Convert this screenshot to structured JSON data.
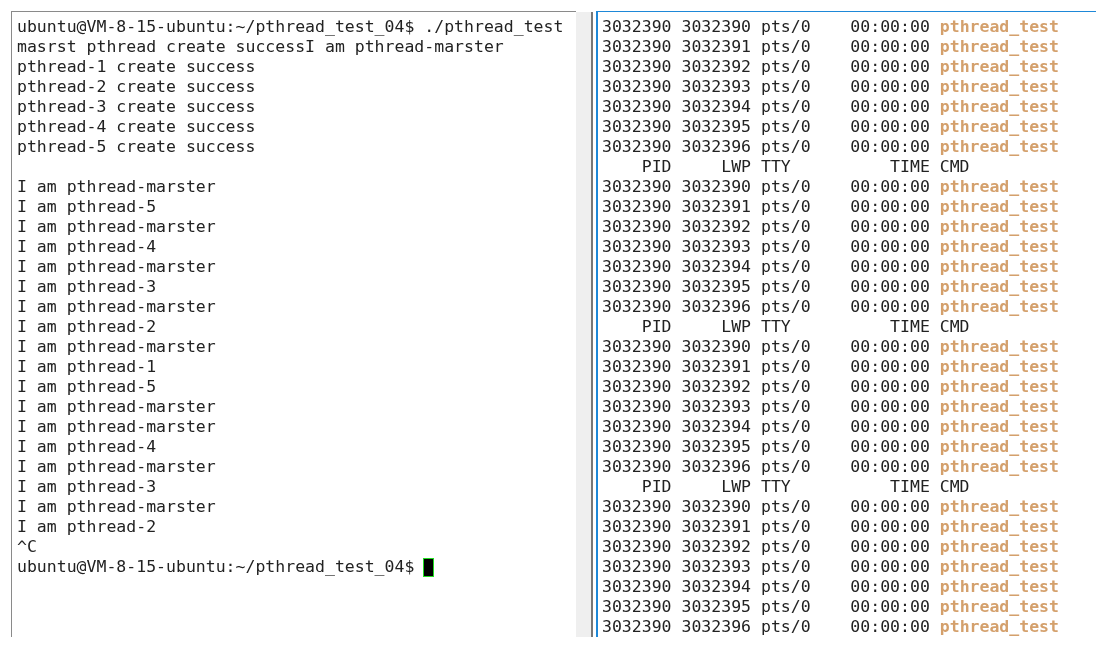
{
  "left_terminal": {
    "lines": [
      "ubuntu@VM-8-15-ubuntu:~/pthread_test_04$ ./pthread_test",
      "masrst pthread create successI am pthread-marster",
      "pthread-1 create success",
      "pthread-2 create success",
      "pthread-3 create success",
      "pthread-4 create success",
      "pthread-5 create success"
    ],
    "output_lines": [
      "I am pthread-marster",
      "I am pthread-5",
      "I am pthread-marster",
      "I am pthread-4",
      "I am pthread-marster",
      "I am pthread-3",
      "I am pthread-marster",
      "I am pthread-2",
      "I am pthread-marster",
      "I am pthread-1",
      "I am pthread-5",
      "I am pthread-marster",
      "I am pthread-marster",
      "I am pthread-4",
      "I am pthread-marster",
      "I am pthread-3",
      "I am pthread-marster",
      "I am pthread-2",
      "^C"
    ],
    "prompt": "ubuntu@VM-8-15-ubuntu:~/pthread_test_04$ "
  },
  "right_terminal": {
    "rows": [
      {
        "kind": "process",
        "text": "3032390 3032390 pts/0    00:00:00 ",
        "cmd": "pthread_test"
      },
      {
        "kind": "process",
        "text": "3032390 3032391 pts/0    00:00:00 ",
        "cmd": "pthread_test"
      },
      {
        "kind": "process",
        "text": "3032390 3032392 pts/0    00:00:00 ",
        "cmd": "pthread_test"
      },
      {
        "kind": "process",
        "text": "3032390 3032393 pts/0    00:00:00 ",
        "cmd": "pthread_test"
      },
      {
        "kind": "process",
        "text": "3032390 3032394 pts/0    00:00:00 ",
        "cmd": "pthread_test"
      },
      {
        "kind": "process",
        "text": "3032390 3032395 pts/0    00:00:00 ",
        "cmd": "pthread_test"
      },
      {
        "kind": "process",
        "text": "3032390 3032396 pts/0    00:00:00 ",
        "cmd": "pthread_test"
      },
      {
        "kind": "header",
        "text": "    PID     LWP TTY          TIME CMD"
      },
      {
        "kind": "process",
        "text": "3032390 3032390 pts/0    00:00:00 ",
        "cmd": "pthread_test"
      },
      {
        "kind": "process",
        "text": "3032390 3032391 pts/0    00:00:00 ",
        "cmd": "pthread_test"
      },
      {
        "kind": "process",
        "text": "3032390 3032392 pts/0    00:00:00 ",
        "cmd": "pthread_test"
      },
      {
        "kind": "process",
        "text": "3032390 3032393 pts/0    00:00:00 ",
        "cmd": "pthread_test"
      },
      {
        "kind": "process",
        "text": "3032390 3032394 pts/0    00:00:00 ",
        "cmd": "pthread_test"
      },
      {
        "kind": "process",
        "text": "3032390 3032395 pts/0    00:00:00 ",
        "cmd": "pthread_test"
      },
      {
        "kind": "process",
        "text": "3032390 3032396 pts/0    00:00:00 ",
        "cmd": "pthread_test"
      },
      {
        "kind": "header",
        "text": "    PID     LWP TTY          TIME CMD"
      },
      {
        "kind": "process",
        "text": "3032390 3032390 pts/0    00:00:00 ",
        "cmd": "pthread_test"
      },
      {
        "kind": "process",
        "text": "3032390 3032391 pts/0    00:00:00 ",
        "cmd": "pthread_test"
      },
      {
        "kind": "process",
        "text": "3032390 3032392 pts/0    00:00:00 ",
        "cmd": "pthread_test"
      },
      {
        "kind": "process",
        "text": "3032390 3032393 pts/0    00:00:00 ",
        "cmd": "pthread_test"
      },
      {
        "kind": "process",
        "text": "3032390 3032394 pts/0    00:00:00 ",
        "cmd": "pthread_test"
      },
      {
        "kind": "process",
        "text": "3032390 3032395 pts/0    00:00:00 ",
        "cmd": "pthread_test"
      },
      {
        "kind": "process",
        "text": "3032390 3032396 pts/0    00:00:00 ",
        "cmd": "pthread_test"
      },
      {
        "kind": "header",
        "text": "    PID     LWP TTY          TIME CMD"
      },
      {
        "kind": "process",
        "text": "3032390 3032390 pts/0    00:00:00 ",
        "cmd": "pthread_test"
      },
      {
        "kind": "process",
        "text": "3032390 3032391 pts/0    00:00:00 ",
        "cmd": "pthread_test"
      },
      {
        "kind": "process",
        "text": "3032390 3032392 pts/0    00:00:00 ",
        "cmd": "pthread_test"
      },
      {
        "kind": "process",
        "text": "3032390 3032393 pts/0    00:00:00 ",
        "cmd": "pthread_test"
      },
      {
        "kind": "process",
        "text": "3032390 3032394 pts/0    00:00:00 ",
        "cmd": "pthread_test"
      },
      {
        "kind": "process",
        "text": "3032390 3032395 pts/0    00:00:00 ",
        "cmd": "pthread_test"
      },
      {
        "kind": "process",
        "text": "3032390 3032396 pts/0    00:00:00 ",
        "cmd": "pthread_test"
      }
    ]
  }
}
